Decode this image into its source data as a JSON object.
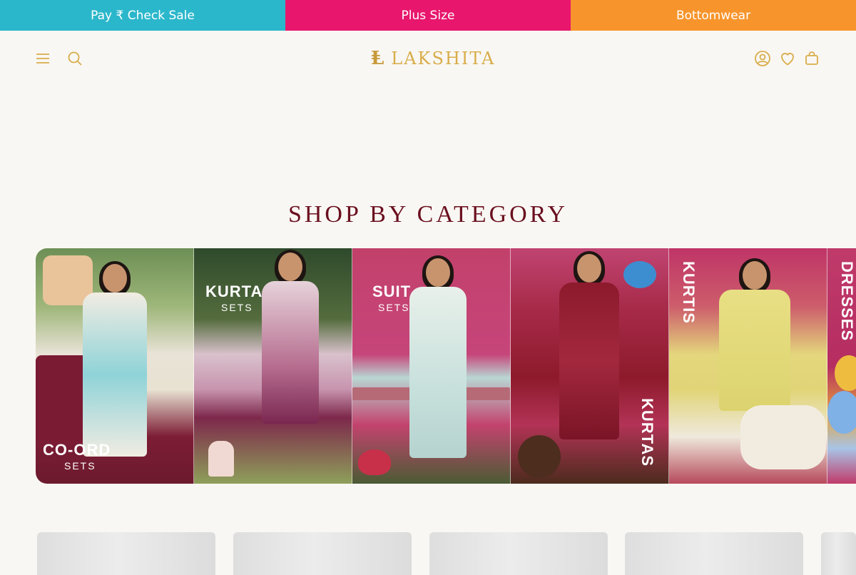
{
  "promo_bar": {
    "items": [
      {
        "label": "Pay ₹ Check Sale"
      },
      {
        "label": "Plus Size"
      },
      {
        "label": "Bottomwear"
      }
    ]
  },
  "header": {
    "logo_mark": "Ⱡ",
    "logo_text": "LAKSHITA",
    "icons": [
      "menu-icon",
      "search-icon",
      "account-icon",
      "wishlist-heart-icon",
      "cart-bag-icon"
    ],
    "accent_color": "#d8ad4a"
  },
  "section": {
    "title": "SHOP BY CATEGORY"
  },
  "categories": [
    {
      "title": "CO-ORD",
      "subtitle": "SETS"
    },
    {
      "title": "KURTA",
      "subtitle": "SETS"
    },
    {
      "title": "SUIT",
      "subtitle": "SETS"
    },
    {
      "title": "KURTAS",
      "subtitle": ""
    },
    {
      "title": "KURTIS",
      "subtitle": ""
    },
    {
      "title": "DRESSES",
      "subtitle": ""
    }
  ],
  "colors": {
    "promo_teal": "#2bb7cb",
    "promo_pink": "#e8176d",
    "promo_orange": "#f7952c",
    "title_maroon": "#6a0f1f",
    "background": "#f9f7f3"
  }
}
